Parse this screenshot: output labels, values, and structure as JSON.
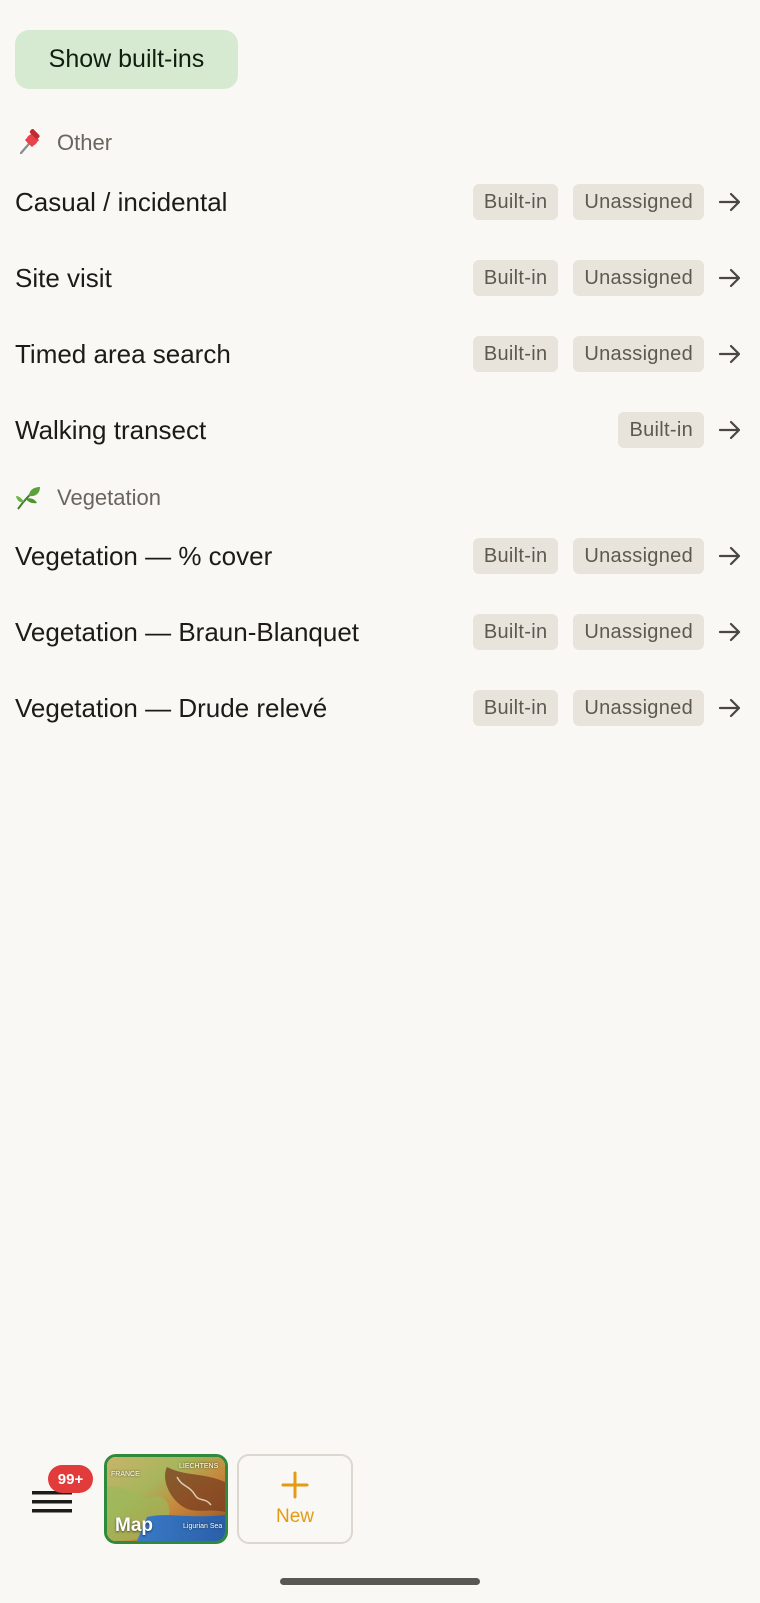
{
  "toolbar": {
    "show_builtins_label": "Show built-ins"
  },
  "sections": [
    {
      "title": "Other",
      "icon": "pushpin-icon",
      "items": [
        {
          "title": "Casual / incidental",
          "badges": [
            "Built-in",
            "Unassigned"
          ]
        },
        {
          "title": "Site visit",
          "badges": [
            "Built-in",
            "Unassigned"
          ]
        },
        {
          "title": "Timed area search",
          "badges": [
            "Built-in",
            "Unassigned"
          ]
        },
        {
          "title": "Walking transect",
          "badges": [
            "Built-in"
          ]
        }
      ]
    },
    {
      "title": "Vegetation",
      "icon": "leaf-icon",
      "items": [
        {
          "title": "Vegetation — % cover",
          "badges": [
            "Built-in",
            "Unassigned"
          ]
        },
        {
          "title": "Vegetation — Braun-Blanquet",
          "badges": [
            "Built-in",
            "Unassigned"
          ]
        },
        {
          "title": "Vegetation — Drude relevé",
          "badges": [
            "Built-in",
            "Unassigned"
          ]
        }
      ]
    }
  ],
  "bottom_bar": {
    "notification_count": "99+",
    "map_label": "Map",
    "map_place_labels": [
      "FRANCE",
      "LIECHTENS",
      "Ligurian Sea"
    ],
    "new_label": "New"
  },
  "colors": {
    "background": "#faf8f5",
    "show_builtins_bg": "#d6ead2",
    "badge_bg": "#e8e4dc",
    "notification": "#e23b3b",
    "new_accent": "#e39a14",
    "map_border": "#2f8a3b"
  }
}
